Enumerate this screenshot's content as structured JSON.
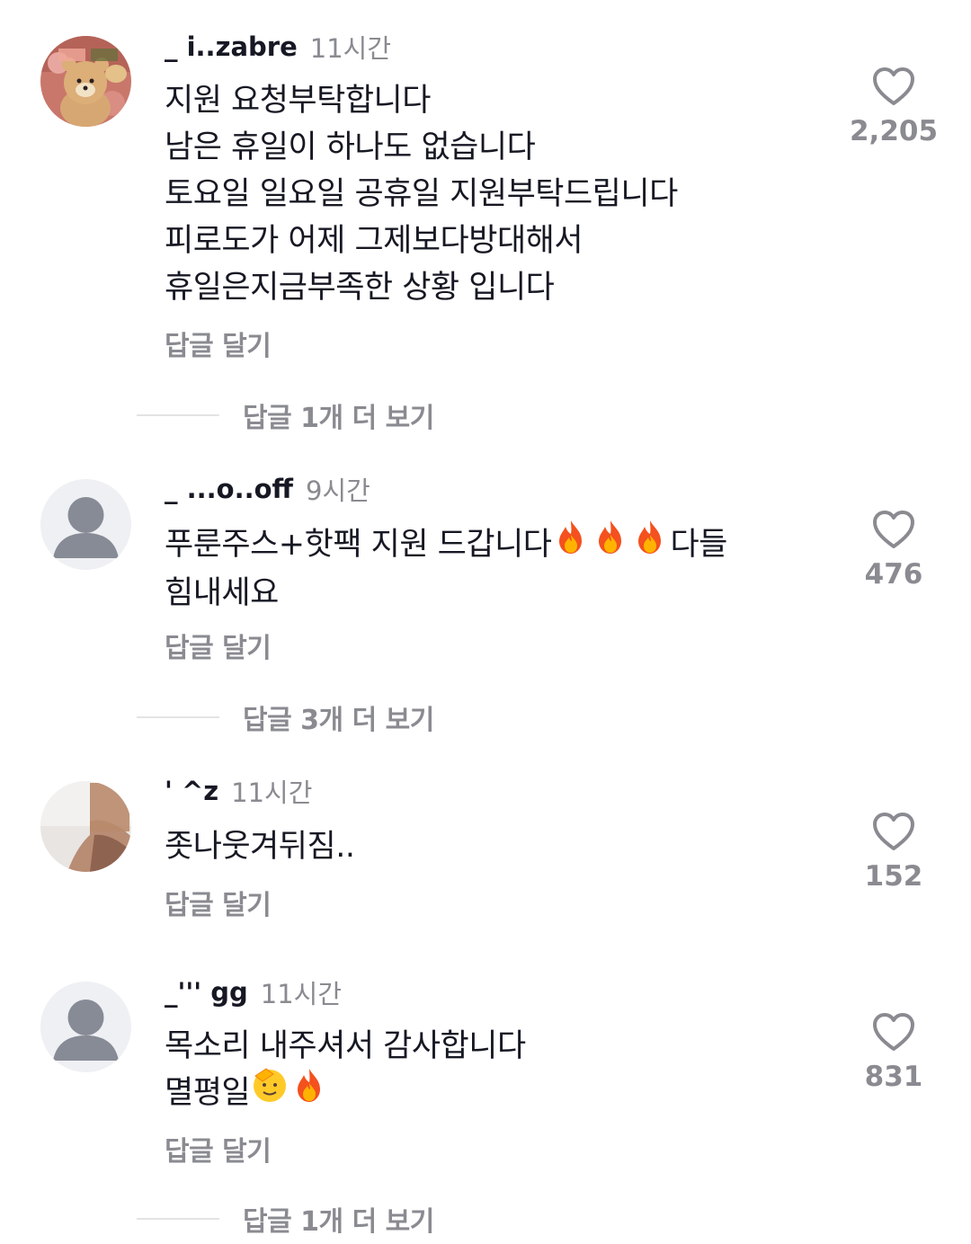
{
  "comments": [
    {
      "username": "_ i..zabre",
      "time": "11시간",
      "text": "지원 요청부탁합니다\n남은 휴일이 하나도 없습니다\n토요일 일요일 공휴일 지원부탁드립니다\n피로도가 어제 그제보다방대해서\n휴일은지금부족한 상황 입니다",
      "reply_label": "답글 달기",
      "likes": "2,205",
      "more_replies": "답글 1개 더 보기",
      "avatar_icon": "bear-plush-avatar"
    },
    {
      "username": "_ ...o..off",
      "time": "9시간",
      "text_part1": "푸룬주스+핫팩 지원 드갑니다",
      "text_part2": "다들",
      "text_line2": "힘내세요",
      "reply_label": "답글 달기",
      "likes": "476",
      "more_replies": "답글 3개 더 보기",
      "avatar_icon": "default-user-avatar"
    },
    {
      "username": "' ^z",
      "time": "11시간",
      "text": "좃나웃겨뒤짐..",
      "reply_label": "답글 달기",
      "likes": "152",
      "avatar_icon": "photo-avatar"
    },
    {
      "username": "_''' gg",
      "time": "11시간",
      "text_line1": "목소리 내주셔서 감사합니다",
      "text_line2": "멸평일",
      "reply_label": "답글 달기",
      "likes": "831",
      "more_replies": "답글 1개 더 보기",
      "avatar_icon": "default-user-avatar"
    }
  ],
  "colors": {
    "primary_text": "#161823",
    "secondary_text": "#8a8b91",
    "divider": "#e3e3e4",
    "default_avatar_bg": "#eff0f3",
    "default_avatar_fg": "#878b96"
  }
}
